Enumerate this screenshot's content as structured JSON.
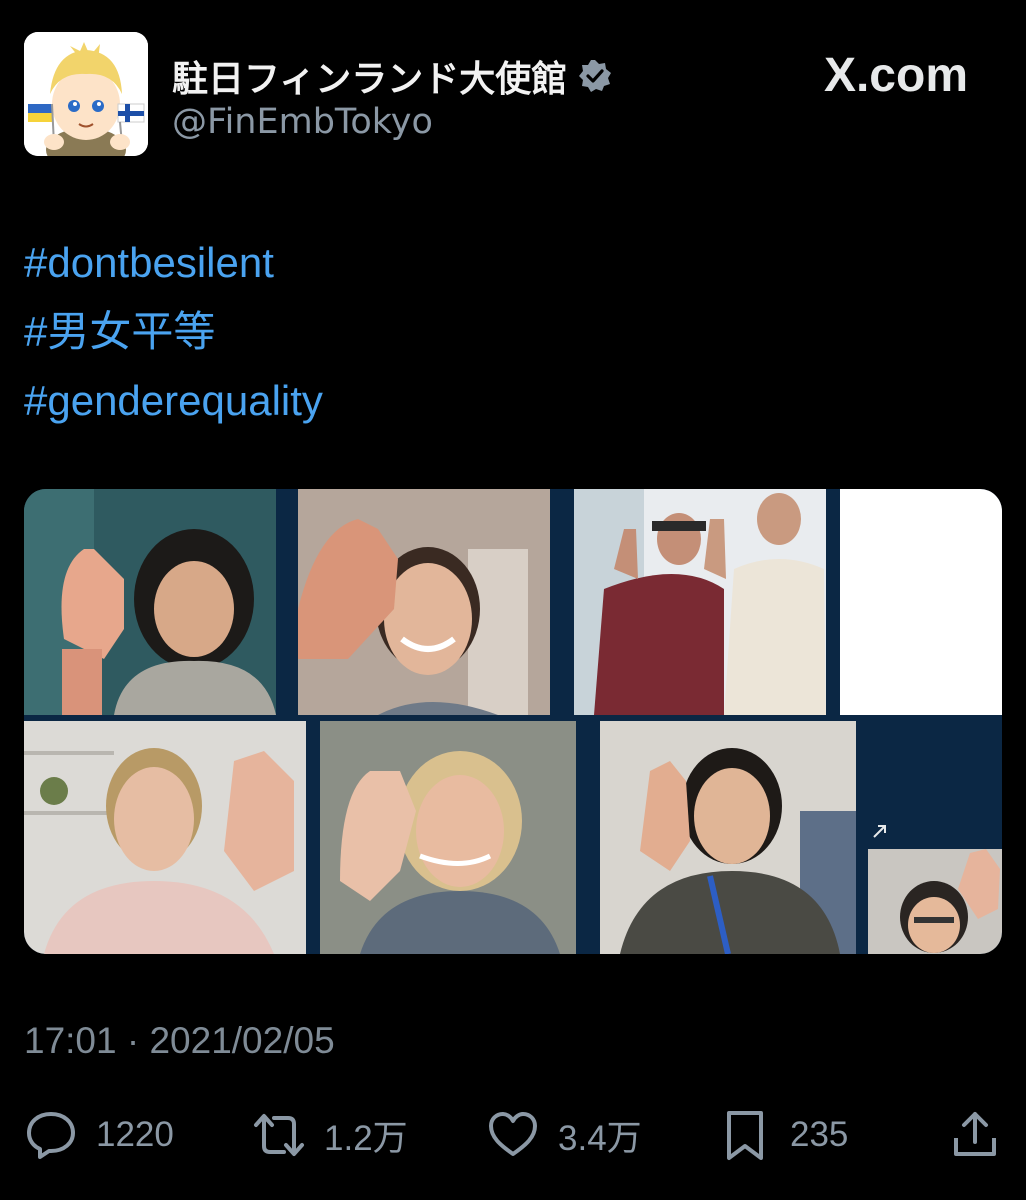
{
  "author": {
    "display_name": "駐日フィンランド大使館",
    "handle": "@FinEmbTokyo",
    "verified": true,
    "avatar_icon": "cartoon-boy-holding-ukraine-and-finland-flags"
  },
  "brand": {
    "text": "X.com"
  },
  "tweet": {
    "hashtags": [
      "#dontbesilent",
      "#男女平等",
      "#genderequality"
    ],
    "media": {
      "description_icon": "video-call-grid-participants-raising-hands",
      "tiles_count": 8
    },
    "timestamp": "17:01 · 2021/02/05"
  },
  "actions": {
    "reply": {
      "icon": "reply-icon",
      "count": "1220"
    },
    "retweet": {
      "icon": "retweet-icon",
      "count": "1.2万"
    },
    "like": {
      "icon": "heart-icon",
      "count": "3.4万"
    },
    "bookmark": {
      "icon": "bookmark-icon",
      "count": "235"
    },
    "share": {
      "icon": "share-icon"
    }
  },
  "colors": {
    "background": "#000000",
    "hashtag": "#4aa3f0",
    "secondary_text": "#8b98a5",
    "media_frame": "#0b2744"
  }
}
